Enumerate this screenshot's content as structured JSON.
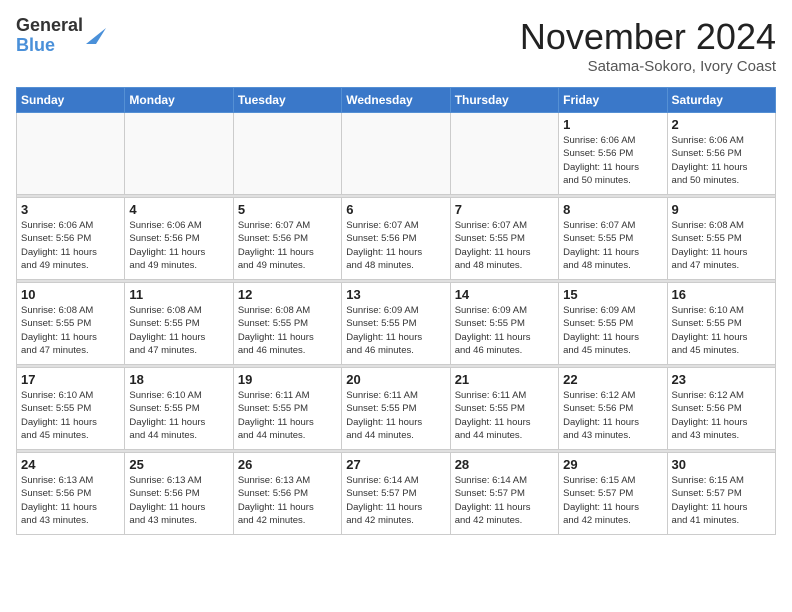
{
  "header": {
    "logo_line1": "General",
    "logo_line2": "Blue",
    "month": "November 2024",
    "location": "Satama-Sokoro, Ivory Coast"
  },
  "weekdays": [
    "Sunday",
    "Monday",
    "Tuesday",
    "Wednesday",
    "Thursday",
    "Friday",
    "Saturday"
  ],
  "weeks": [
    [
      {
        "day": "",
        "info": ""
      },
      {
        "day": "",
        "info": ""
      },
      {
        "day": "",
        "info": ""
      },
      {
        "day": "",
        "info": ""
      },
      {
        "day": "",
        "info": ""
      },
      {
        "day": "1",
        "info": "Sunrise: 6:06 AM\nSunset: 5:56 PM\nDaylight: 11 hours\nand 50 minutes."
      },
      {
        "day": "2",
        "info": "Sunrise: 6:06 AM\nSunset: 5:56 PM\nDaylight: 11 hours\nand 50 minutes."
      }
    ],
    [
      {
        "day": "3",
        "info": "Sunrise: 6:06 AM\nSunset: 5:56 PM\nDaylight: 11 hours\nand 49 minutes."
      },
      {
        "day": "4",
        "info": "Sunrise: 6:06 AM\nSunset: 5:56 PM\nDaylight: 11 hours\nand 49 minutes."
      },
      {
        "day": "5",
        "info": "Sunrise: 6:07 AM\nSunset: 5:56 PM\nDaylight: 11 hours\nand 49 minutes."
      },
      {
        "day": "6",
        "info": "Sunrise: 6:07 AM\nSunset: 5:56 PM\nDaylight: 11 hours\nand 48 minutes."
      },
      {
        "day": "7",
        "info": "Sunrise: 6:07 AM\nSunset: 5:55 PM\nDaylight: 11 hours\nand 48 minutes."
      },
      {
        "day": "8",
        "info": "Sunrise: 6:07 AM\nSunset: 5:55 PM\nDaylight: 11 hours\nand 48 minutes."
      },
      {
        "day": "9",
        "info": "Sunrise: 6:08 AM\nSunset: 5:55 PM\nDaylight: 11 hours\nand 47 minutes."
      }
    ],
    [
      {
        "day": "10",
        "info": "Sunrise: 6:08 AM\nSunset: 5:55 PM\nDaylight: 11 hours\nand 47 minutes."
      },
      {
        "day": "11",
        "info": "Sunrise: 6:08 AM\nSunset: 5:55 PM\nDaylight: 11 hours\nand 47 minutes."
      },
      {
        "day": "12",
        "info": "Sunrise: 6:08 AM\nSunset: 5:55 PM\nDaylight: 11 hours\nand 46 minutes."
      },
      {
        "day": "13",
        "info": "Sunrise: 6:09 AM\nSunset: 5:55 PM\nDaylight: 11 hours\nand 46 minutes."
      },
      {
        "day": "14",
        "info": "Sunrise: 6:09 AM\nSunset: 5:55 PM\nDaylight: 11 hours\nand 46 minutes."
      },
      {
        "day": "15",
        "info": "Sunrise: 6:09 AM\nSunset: 5:55 PM\nDaylight: 11 hours\nand 45 minutes."
      },
      {
        "day": "16",
        "info": "Sunrise: 6:10 AM\nSunset: 5:55 PM\nDaylight: 11 hours\nand 45 minutes."
      }
    ],
    [
      {
        "day": "17",
        "info": "Sunrise: 6:10 AM\nSunset: 5:55 PM\nDaylight: 11 hours\nand 45 minutes."
      },
      {
        "day": "18",
        "info": "Sunrise: 6:10 AM\nSunset: 5:55 PM\nDaylight: 11 hours\nand 44 minutes."
      },
      {
        "day": "19",
        "info": "Sunrise: 6:11 AM\nSunset: 5:55 PM\nDaylight: 11 hours\nand 44 minutes."
      },
      {
        "day": "20",
        "info": "Sunrise: 6:11 AM\nSunset: 5:55 PM\nDaylight: 11 hours\nand 44 minutes."
      },
      {
        "day": "21",
        "info": "Sunrise: 6:11 AM\nSunset: 5:55 PM\nDaylight: 11 hours\nand 44 minutes."
      },
      {
        "day": "22",
        "info": "Sunrise: 6:12 AM\nSunset: 5:56 PM\nDaylight: 11 hours\nand 43 minutes."
      },
      {
        "day": "23",
        "info": "Sunrise: 6:12 AM\nSunset: 5:56 PM\nDaylight: 11 hours\nand 43 minutes."
      }
    ],
    [
      {
        "day": "24",
        "info": "Sunrise: 6:13 AM\nSunset: 5:56 PM\nDaylight: 11 hours\nand 43 minutes."
      },
      {
        "day": "25",
        "info": "Sunrise: 6:13 AM\nSunset: 5:56 PM\nDaylight: 11 hours\nand 43 minutes."
      },
      {
        "day": "26",
        "info": "Sunrise: 6:13 AM\nSunset: 5:56 PM\nDaylight: 11 hours\nand 42 minutes."
      },
      {
        "day": "27",
        "info": "Sunrise: 6:14 AM\nSunset: 5:57 PM\nDaylight: 11 hours\nand 42 minutes."
      },
      {
        "day": "28",
        "info": "Sunrise: 6:14 AM\nSunset: 5:57 PM\nDaylight: 11 hours\nand 42 minutes."
      },
      {
        "day": "29",
        "info": "Sunrise: 6:15 AM\nSunset: 5:57 PM\nDaylight: 11 hours\nand 42 minutes."
      },
      {
        "day": "30",
        "info": "Sunrise: 6:15 AM\nSunset: 5:57 PM\nDaylight: 11 hours\nand 41 minutes."
      }
    ]
  ]
}
